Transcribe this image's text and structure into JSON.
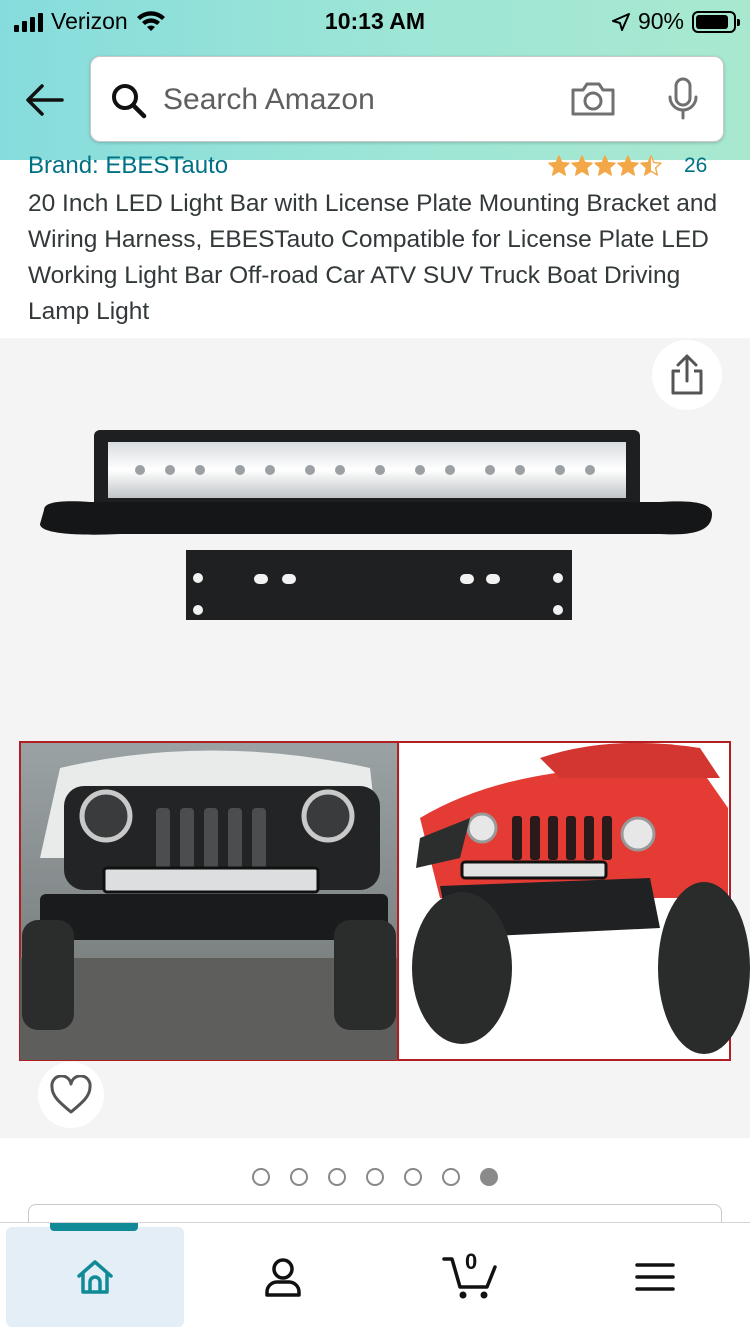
{
  "status_bar": {
    "carrier": "Verizon",
    "time": "10:13 AM",
    "battery": "90%",
    "battery_level": 0.9
  },
  "search": {
    "placeholder": "Search Amazon",
    "icons": [
      "back-arrow-icon",
      "search-icon",
      "camera-icon",
      "microphone-icon"
    ]
  },
  "product": {
    "brand": "Brand: EBESTauto",
    "rating_stars": 4.5,
    "rating_count": "26",
    "title": "20 Inch LED Light Bar with License Plate Mounting Bracket and Wiring Harness, EBESTauto Compatible for License Plate LED Working Light Bar Off-road Car ATV SUV Truck Boat Driving Lamp Light"
  },
  "gallery": {
    "image_count": 7,
    "active_index": 6,
    "icons": [
      "share-icon",
      "heart-icon"
    ]
  },
  "bottom_nav": {
    "items": [
      {
        "name": "home",
        "icon": "home-icon"
      },
      {
        "name": "account",
        "icon": "person-icon"
      },
      {
        "name": "cart",
        "icon": "cart-icon"
      },
      {
        "name": "menu",
        "icon": "hamburger-menu-icon"
      }
    ],
    "cart_count": "0"
  },
  "colors": {
    "header_gradient_start": "#86dcdc",
    "header_gradient_end": "#a8e8cf",
    "link": "#007185",
    "star": "#f3a847",
    "nav_active": "#0f8a96"
  }
}
